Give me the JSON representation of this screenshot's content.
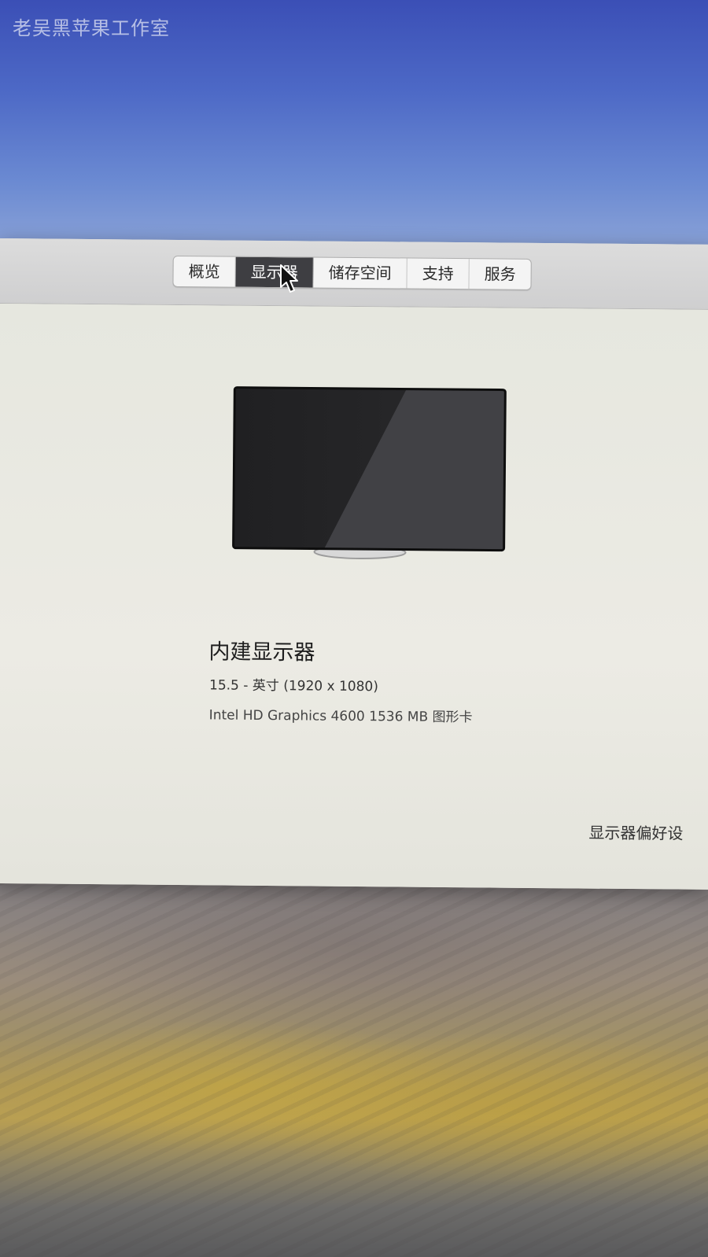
{
  "watermark": "老吴黑苹果工作室",
  "tabs": [
    {
      "label": "概览",
      "active": false
    },
    {
      "label": "显示器",
      "active": true
    },
    {
      "label": "储存空间",
      "active": false
    },
    {
      "label": "支持",
      "active": false
    },
    {
      "label": "服务",
      "active": false
    }
  ],
  "display": {
    "icon": "display-icon",
    "name": "内建显示器",
    "size_resolution": "15.5 - 英寸 (1920 x 1080)",
    "graphics": "Intel HD Graphics 4600 1536 MB 图形卡"
  },
  "prefs_button": {
    "label": "显示器偏好设"
  },
  "colors": {
    "active_tab": "#3e3e42",
    "window_bg": "#ebebe3",
    "sky": "#4d69c6"
  }
}
